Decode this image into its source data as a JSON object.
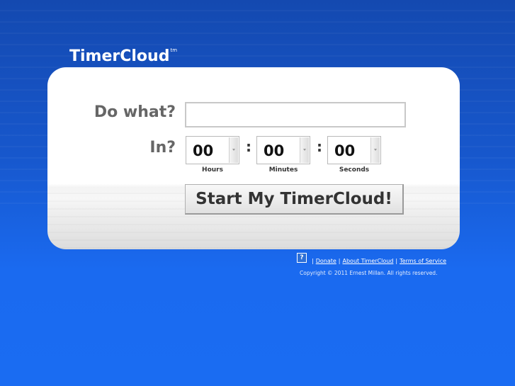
{
  "header": {
    "logo_text": "TimerCloud",
    "logo_mark": "tm"
  },
  "form": {
    "task_label": "Do what?",
    "task_value": "",
    "task_placeholder": "",
    "time_label": "In?",
    "hours": {
      "value": "00",
      "unit": "Hours"
    },
    "minutes": {
      "value": "00",
      "unit": "Minutes"
    },
    "seconds": {
      "value": "00",
      "unit": "Seconds"
    },
    "separator": ":",
    "start_label": "Start My TimerCloud!"
  },
  "footer": {
    "help_icon": "help-icon",
    "help_glyph": "?",
    "links": [
      "Donate",
      "About TimerCloud",
      "Terms of Service"
    ],
    "separator": "|",
    "copyright": "Copyright © 2011 Ernest Millan. All rights reserved."
  },
  "colors": {
    "background_top": "#1449b0",
    "background_bottom": "#1a6cf2",
    "card": "#ffffff",
    "label": "#666666"
  }
}
